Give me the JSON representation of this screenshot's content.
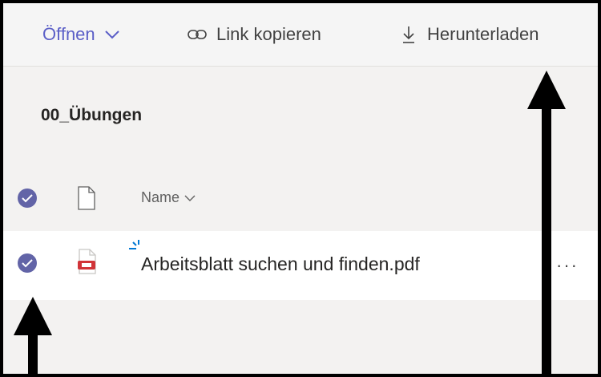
{
  "toolbar": {
    "open_label": "Öffnen",
    "copy_link_label": "Link kopieren",
    "download_label": "Herunterladen"
  },
  "folder": {
    "title": "00_Übungen"
  },
  "columns": {
    "name_label": "Name"
  },
  "files": [
    {
      "name": "Arbeitsblatt suchen und finden.pdf",
      "more_label": "···"
    }
  ],
  "colors": {
    "accent": "#6264a7",
    "pdf_icon": "#d13438",
    "sync_indicator": "#0078d4",
    "annotation_arrow": "#000000"
  }
}
